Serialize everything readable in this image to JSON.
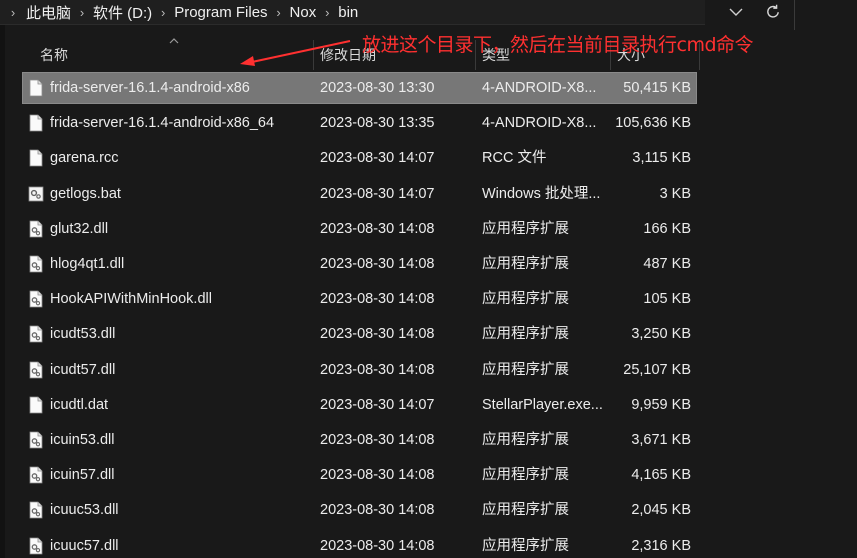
{
  "breadcrumb": {
    "items": [
      "此电脑",
      "软件 (D:)",
      "Program Files",
      "Nox",
      "bin"
    ]
  },
  "columns": {
    "name": "名称",
    "modified": "修改日期",
    "type": "类型",
    "size": "大小"
  },
  "annotation": {
    "text": "放进这个目录下，然后在当前目录执行cmd命令",
    "color": "#ff3030"
  },
  "files": [
    {
      "name": "frida-server-16.1.4-android-x86",
      "modified": "2023-08-30 13:30",
      "type": "4-ANDROID-X8...",
      "size": "50,415 KB",
      "icon": "blank-file-icon",
      "selected": true
    },
    {
      "name": "frida-server-16.1.4-android-x86_64",
      "modified": "2023-08-30 13:35",
      "type": "4-ANDROID-X8...",
      "size": "105,636 KB",
      "icon": "blank-file-icon",
      "selected": false
    },
    {
      "name": "garena.rcc",
      "modified": "2023-08-30 14:07",
      "type": "RCC 文件",
      "size": "3,115 KB",
      "icon": "blank-file-icon",
      "selected": false
    },
    {
      "name": "getlogs.bat",
      "modified": "2023-08-30 14:07",
      "type": "Windows 批处理...",
      "size": "3 KB",
      "icon": "batch-file-icon",
      "selected": false
    },
    {
      "name": "glut32.dll",
      "modified": "2023-08-30 14:08",
      "type": "应用程序扩展",
      "size": "166 KB",
      "icon": "dll-file-icon",
      "selected": false
    },
    {
      "name": "hlog4qt1.dll",
      "modified": "2023-08-30 14:08",
      "type": "应用程序扩展",
      "size": "487 KB",
      "icon": "dll-file-icon",
      "selected": false
    },
    {
      "name": "HookAPIWithMinHook.dll",
      "modified": "2023-08-30 14:08",
      "type": "应用程序扩展",
      "size": "105 KB",
      "icon": "dll-file-icon",
      "selected": false
    },
    {
      "name": "icudt53.dll",
      "modified": "2023-08-30 14:08",
      "type": "应用程序扩展",
      "size": "3,250 KB",
      "icon": "dll-file-icon",
      "selected": false
    },
    {
      "name": "icudt57.dll",
      "modified": "2023-08-30 14:08",
      "type": "应用程序扩展",
      "size": "25,107 KB",
      "icon": "dll-file-icon",
      "selected": false
    },
    {
      "name": "icudtl.dat",
      "modified": "2023-08-30 14:07",
      "type": "StellarPlayer.exe...",
      "size": "9,959 KB",
      "icon": "blank-file-icon",
      "selected": false
    },
    {
      "name": "icuin53.dll",
      "modified": "2023-08-30 14:08",
      "type": "应用程序扩展",
      "size": "3,671 KB",
      "icon": "dll-file-icon",
      "selected": false
    },
    {
      "name": "icuin57.dll",
      "modified": "2023-08-30 14:08",
      "type": "应用程序扩展",
      "size": "4,165 KB",
      "icon": "dll-file-icon",
      "selected": false
    },
    {
      "name": "icuuc53.dll",
      "modified": "2023-08-30 14:08",
      "type": "应用程序扩展",
      "size": "2,045 KB",
      "icon": "dll-file-icon",
      "selected": false
    },
    {
      "name": "icuuc57.dll",
      "modified": "2023-08-30 14:08",
      "type": "应用程序扩展",
      "size": "2,316 KB",
      "icon": "dll-file-icon",
      "selected": false
    }
  ]
}
